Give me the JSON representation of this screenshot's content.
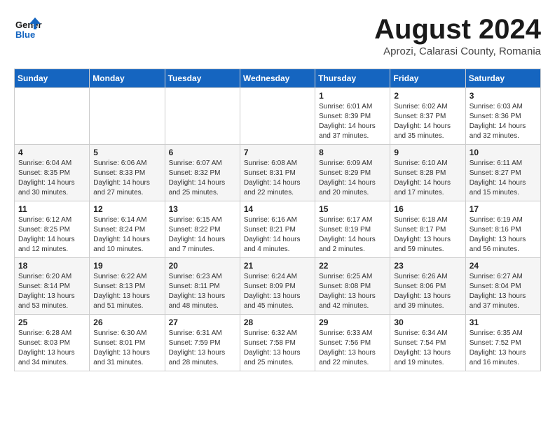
{
  "header": {
    "logo_general": "General",
    "logo_blue": "Blue",
    "title": "August 2024",
    "subtitle": "Aprozi, Calarasi County, Romania"
  },
  "weekdays": [
    "Sunday",
    "Monday",
    "Tuesday",
    "Wednesday",
    "Thursday",
    "Friday",
    "Saturday"
  ],
  "weeks": [
    [
      {
        "day": "",
        "info": ""
      },
      {
        "day": "",
        "info": ""
      },
      {
        "day": "",
        "info": ""
      },
      {
        "day": "",
        "info": ""
      },
      {
        "day": "1",
        "info": "Sunrise: 6:01 AM\nSunset: 8:39 PM\nDaylight: 14 hours\nand 37 minutes."
      },
      {
        "day": "2",
        "info": "Sunrise: 6:02 AM\nSunset: 8:37 PM\nDaylight: 14 hours\nand 35 minutes."
      },
      {
        "day": "3",
        "info": "Sunrise: 6:03 AM\nSunset: 8:36 PM\nDaylight: 14 hours\nand 32 minutes."
      }
    ],
    [
      {
        "day": "4",
        "info": "Sunrise: 6:04 AM\nSunset: 8:35 PM\nDaylight: 14 hours\nand 30 minutes."
      },
      {
        "day": "5",
        "info": "Sunrise: 6:06 AM\nSunset: 8:33 PM\nDaylight: 14 hours\nand 27 minutes."
      },
      {
        "day": "6",
        "info": "Sunrise: 6:07 AM\nSunset: 8:32 PM\nDaylight: 14 hours\nand 25 minutes."
      },
      {
        "day": "7",
        "info": "Sunrise: 6:08 AM\nSunset: 8:31 PM\nDaylight: 14 hours\nand 22 minutes."
      },
      {
        "day": "8",
        "info": "Sunrise: 6:09 AM\nSunset: 8:29 PM\nDaylight: 14 hours\nand 20 minutes."
      },
      {
        "day": "9",
        "info": "Sunrise: 6:10 AM\nSunset: 8:28 PM\nDaylight: 14 hours\nand 17 minutes."
      },
      {
        "day": "10",
        "info": "Sunrise: 6:11 AM\nSunset: 8:27 PM\nDaylight: 14 hours\nand 15 minutes."
      }
    ],
    [
      {
        "day": "11",
        "info": "Sunrise: 6:12 AM\nSunset: 8:25 PM\nDaylight: 14 hours\nand 12 minutes."
      },
      {
        "day": "12",
        "info": "Sunrise: 6:14 AM\nSunset: 8:24 PM\nDaylight: 14 hours\nand 10 minutes."
      },
      {
        "day": "13",
        "info": "Sunrise: 6:15 AM\nSunset: 8:22 PM\nDaylight: 14 hours\nand 7 minutes."
      },
      {
        "day": "14",
        "info": "Sunrise: 6:16 AM\nSunset: 8:21 PM\nDaylight: 14 hours\nand 4 minutes."
      },
      {
        "day": "15",
        "info": "Sunrise: 6:17 AM\nSunset: 8:19 PM\nDaylight: 14 hours\nand 2 minutes."
      },
      {
        "day": "16",
        "info": "Sunrise: 6:18 AM\nSunset: 8:17 PM\nDaylight: 13 hours\nand 59 minutes."
      },
      {
        "day": "17",
        "info": "Sunrise: 6:19 AM\nSunset: 8:16 PM\nDaylight: 13 hours\nand 56 minutes."
      }
    ],
    [
      {
        "day": "18",
        "info": "Sunrise: 6:20 AM\nSunset: 8:14 PM\nDaylight: 13 hours\nand 53 minutes."
      },
      {
        "day": "19",
        "info": "Sunrise: 6:22 AM\nSunset: 8:13 PM\nDaylight: 13 hours\nand 51 minutes."
      },
      {
        "day": "20",
        "info": "Sunrise: 6:23 AM\nSunset: 8:11 PM\nDaylight: 13 hours\nand 48 minutes."
      },
      {
        "day": "21",
        "info": "Sunrise: 6:24 AM\nSunset: 8:09 PM\nDaylight: 13 hours\nand 45 minutes."
      },
      {
        "day": "22",
        "info": "Sunrise: 6:25 AM\nSunset: 8:08 PM\nDaylight: 13 hours\nand 42 minutes."
      },
      {
        "day": "23",
        "info": "Sunrise: 6:26 AM\nSunset: 8:06 PM\nDaylight: 13 hours\nand 39 minutes."
      },
      {
        "day": "24",
        "info": "Sunrise: 6:27 AM\nSunset: 8:04 PM\nDaylight: 13 hours\nand 37 minutes."
      }
    ],
    [
      {
        "day": "25",
        "info": "Sunrise: 6:28 AM\nSunset: 8:03 PM\nDaylight: 13 hours\nand 34 minutes."
      },
      {
        "day": "26",
        "info": "Sunrise: 6:30 AM\nSunset: 8:01 PM\nDaylight: 13 hours\nand 31 minutes."
      },
      {
        "day": "27",
        "info": "Sunrise: 6:31 AM\nSunset: 7:59 PM\nDaylight: 13 hours\nand 28 minutes."
      },
      {
        "day": "28",
        "info": "Sunrise: 6:32 AM\nSunset: 7:58 PM\nDaylight: 13 hours\nand 25 minutes."
      },
      {
        "day": "29",
        "info": "Sunrise: 6:33 AM\nSunset: 7:56 PM\nDaylight: 13 hours\nand 22 minutes."
      },
      {
        "day": "30",
        "info": "Sunrise: 6:34 AM\nSunset: 7:54 PM\nDaylight: 13 hours\nand 19 minutes."
      },
      {
        "day": "31",
        "info": "Sunrise: 6:35 AM\nSunset: 7:52 PM\nDaylight: 13 hours\nand 16 minutes."
      }
    ]
  ]
}
